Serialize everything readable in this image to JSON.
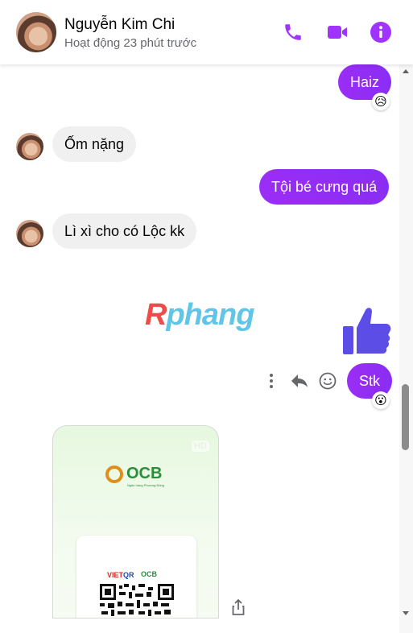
{
  "contact": {
    "name": "Nguyễn Kim Chi",
    "status": "Hoạt động 23 phút trước"
  },
  "header_icons": [
    "phone-icon",
    "video-icon",
    "info-icon"
  ],
  "accent_color": "#9b2df6",
  "messages": [
    {
      "direction": "outgoing",
      "text": "Haiz",
      "reaction": "😥"
    },
    {
      "direction": "incoming",
      "text": "Ốm nặng"
    },
    {
      "direction": "outgoing",
      "text": "Tội bé cưng quá"
    },
    {
      "direction": "incoming",
      "text": "Lì xì cho có Lộc kk"
    },
    {
      "direction": "outgoing",
      "type": "like-sticker"
    },
    {
      "direction": "outgoing",
      "text": "Stk",
      "reaction": "😮"
    }
  ],
  "watermark": {
    "first": "R",
    "rest": "phang"
  },
  "message_actions": [
    "more-options-icon",
    "reply-icon",
    "emoji-react-icon"
  ],
  "image_card": {
    "hd_badge": "HD",
    "bank_logo": "OCB",
    "bank_tagline": "Ngân hàng Phương Đông",
    "vietqr_a": "VIET",
    "vietqr_b": "QR",
    "mini_logo": "OCB"
  }
}
